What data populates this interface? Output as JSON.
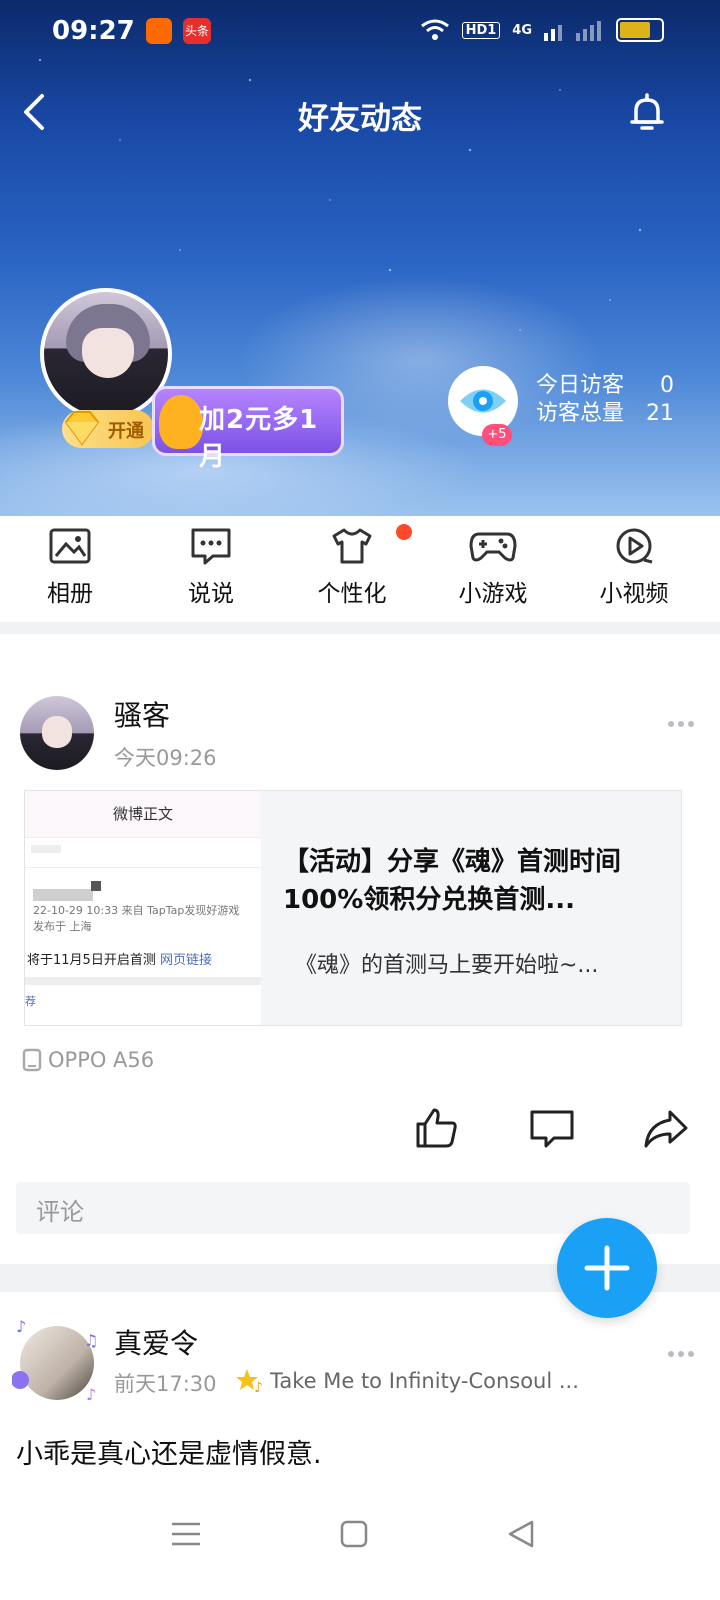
{
  "status_bar": {
    "time": "09:27",
    "app2_label": "头条",
    "hd_label": "HD1",
    "network_label": "4G",
    "icons": [
      "wifi-icon",
      "signal-icon",
      "battery-icon"
    ]
  },
  "header": {
    "title": "好友动态",
    "vip_label": "开通",
    "promo_text": "加2元多1月",
    "visitor_plus": "+5",
    "today_visitors_label": "今日访客",
    "today_visitors_value": "0",
    "total_visitors_label": "访客总量",
    "total_visitors_value": "21"
  },
  "menu": [
    {
      "label": "相册",
      "icon": "album-icon"
    },
    {
      "label": "说说",
      "icon": "shuoshuo-icon"
    },
    {
      "label": "个性化",
      "icon": "tshirt-icon"
    },
    {
      "label": "小游戏",
      "icon": "gamepad-icon"
    },
    {
      "label": "小视频",
      "icon": "video-icon"
    }
  ],
  "post1": {
    "author": "骚客",
    "time": "今天09:26",
    "thumb_header": "微博正文",
    "thumb_meta_line1": "22-10-29 10:33  来自 TapTap发现好游戏",
    "thumb_meta_line2": "发布于 上海",
    "thumb_text": "将于11月5日开启首测",
    "thumb_link": "网页链接",
    "thumb_rec": "荐",
    "title": "【活动】分享《魂》首测时间 100%领积分兑换首测...",
    "subtitle": "《魂》的首测马上要开始啦~...",
    "device": "OPPO A56",
    "comment_placeholder": "评论"
  },
  "post2": {
    "author": "真爱令",
    "time": "前天17:30",
    "song": "Take Me to Infinity-Consoul ...",
    "text": "小乖是真心还是虚情假意."
  },
  "colors": {
    "fab": "#1aa0f5",
    "badge_red": "#ff4a2a",
    "promo_purple": "#7b52e6"
  }
}
